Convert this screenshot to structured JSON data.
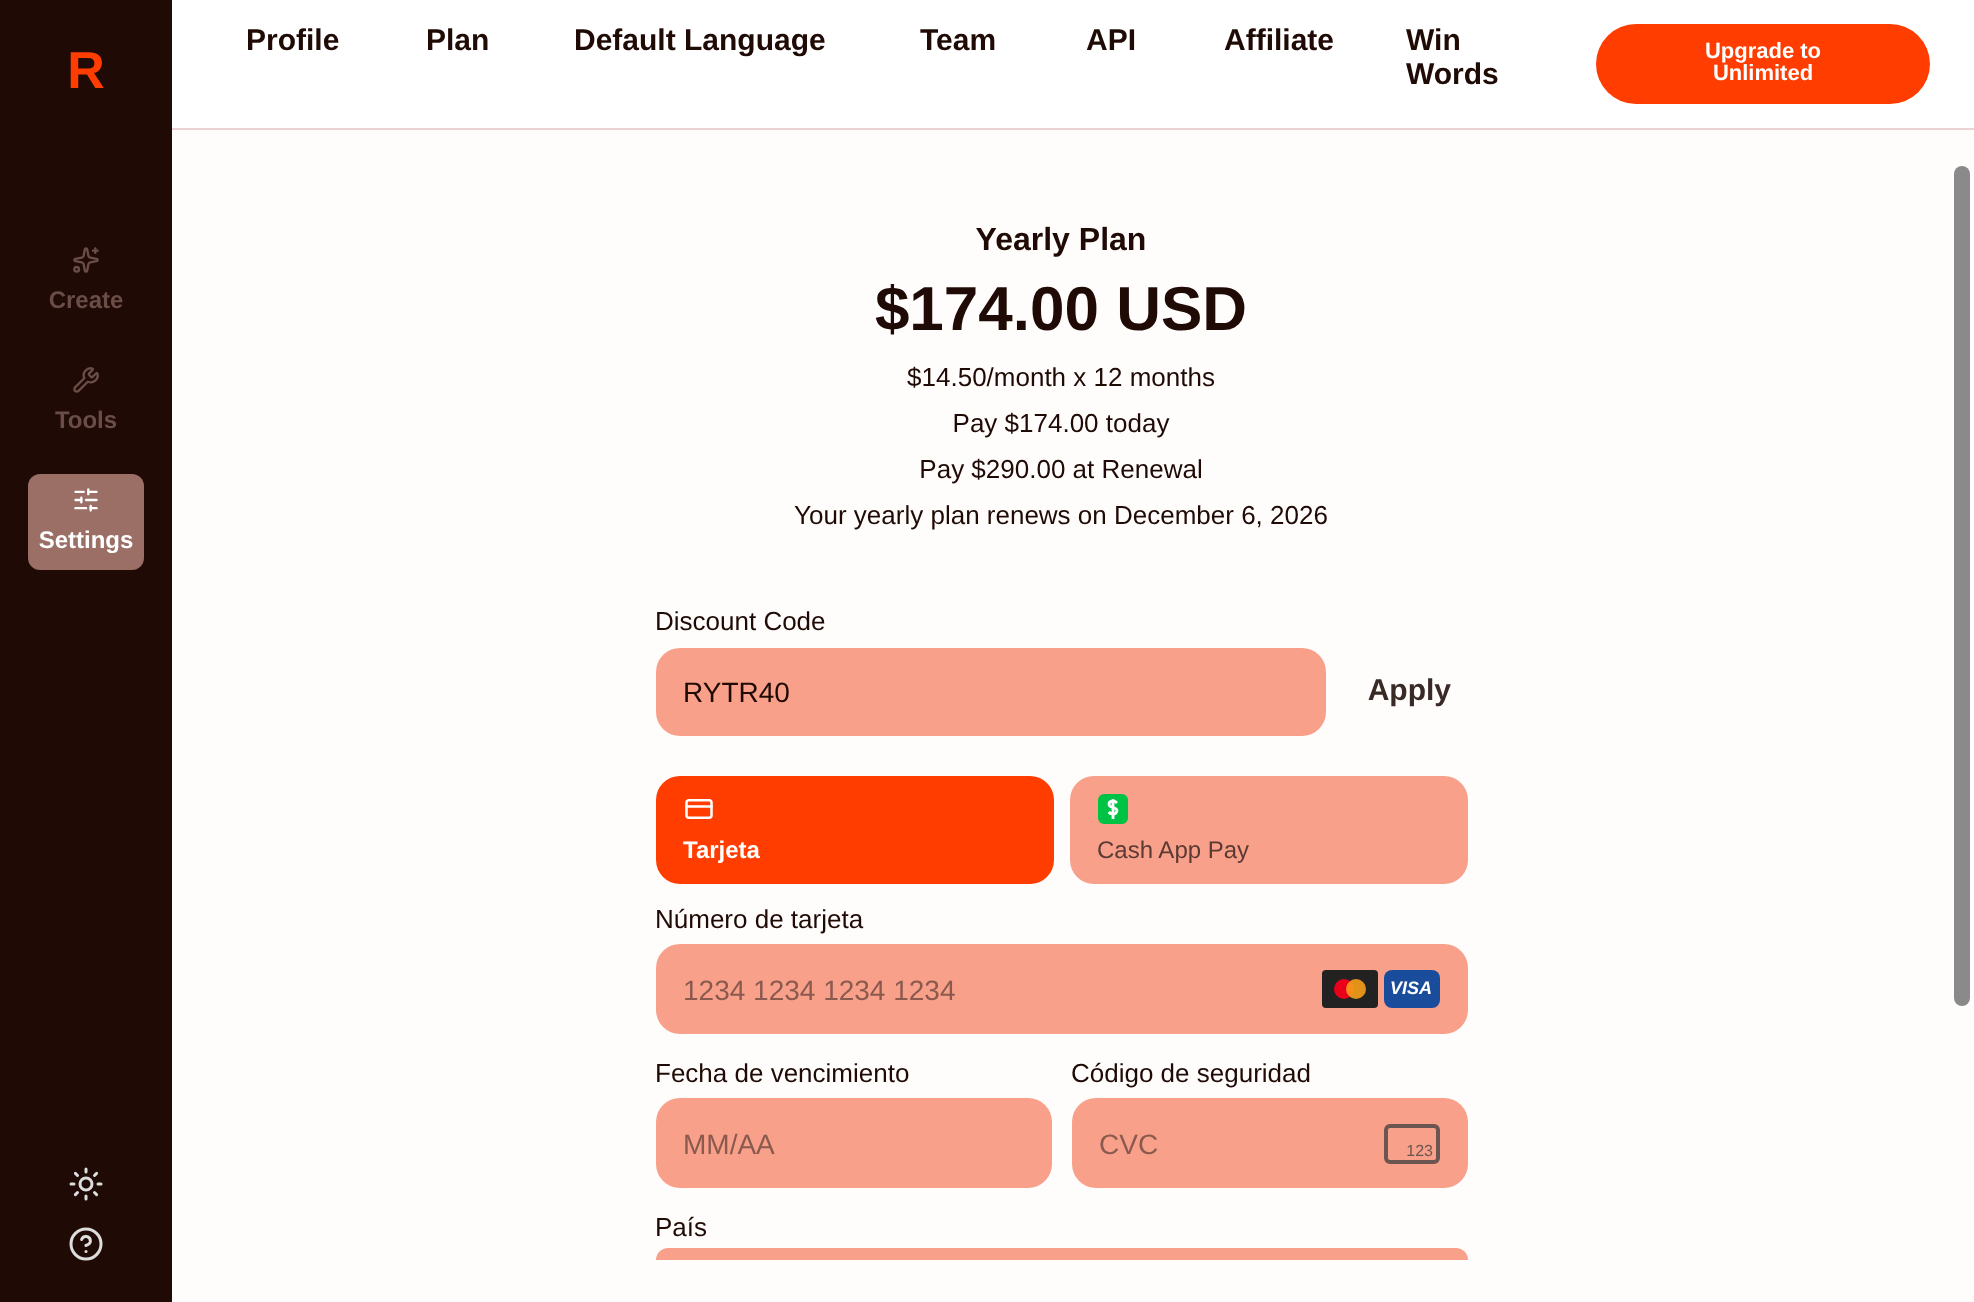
{
  "sidebar": {
    "logo": "R",
    "items": [
      {
        "label": "Create",
        "kind": "create",
        "selected": false
      },
      {
        "label": "Tools",
        "kind": "tools",
        "selected": false
      },
      {
        "label": "Settings",
        "kind": "settings",
        "selected": true
      }
    ]
  },
  "nav": {
    "links": [
      "Profile",
      "Plan",
      "Default Language",
      "Team",
      "API",
      "Affiliate",
      "Win Words"
    ],
    "upgrade_button": "Upgrade to Unlimited"
  },
  "plan": {
    "name": "Yearly Plan",
    "price": "$174.00 USD",
    "details": [
      "$14.50/month x 12 months",
      "Pay $174.00 today",
      "Pay $290.00 at Renewal",
      "Your yearly plan renews on December 6, 2026"
    ]
  },
  "discount": {
    "label": "Discount Code",
    "value": "RYTR40",
    "apply_button": "Apply"
  },
  "payment_methods": [
    {
      "label": "Tarjeta",
      "kind": "card",
      "selected": true
    },
    {
      "label": "Cash App Pay",
      "kind": "cashapp",
      "selected": false
    }
  ],
  "card_number": {
    "label": "Número de tarjeta",
    "placeholder": "1234 1234 1234 1234",
    "visa_badge": "VISA"
  },
  "expiry": {
    "label": "Fecha de vencimiento",
    "placeholder": "MM/AA"
  },
  "security_code": {
    "label": "Código de seguridad",
    "placeholder": "CVC",
    "icon_text": "123"
  },
  "country": {
    "label": "País"
  }
}
